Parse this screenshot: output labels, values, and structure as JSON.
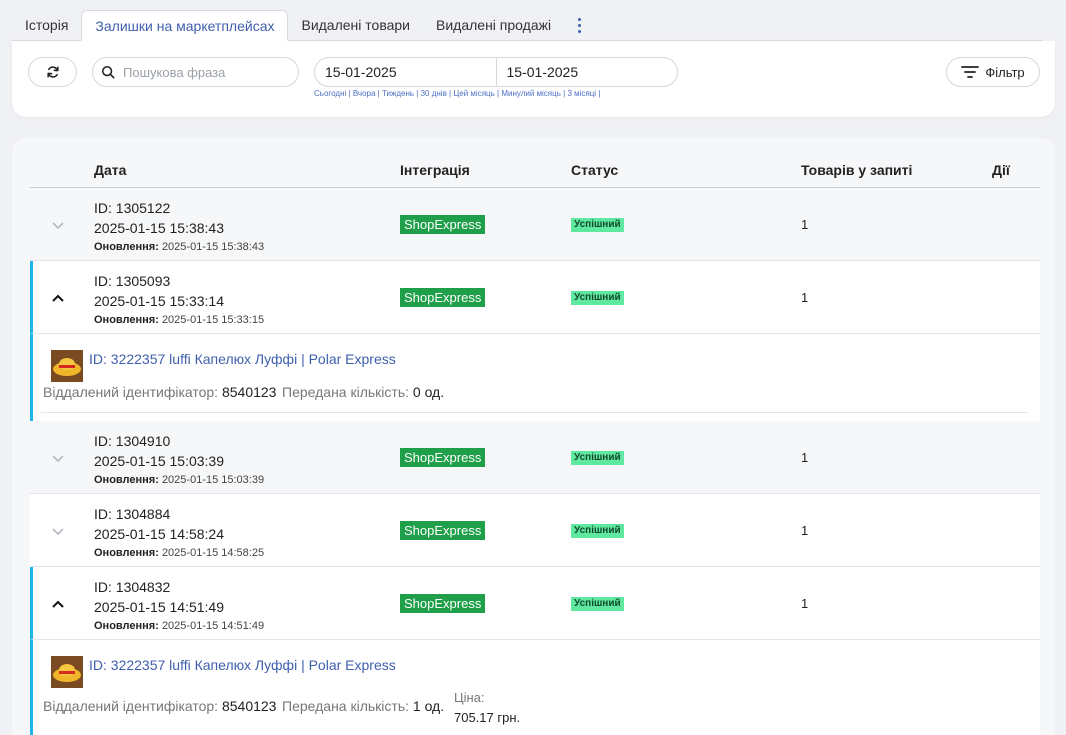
{
  "tabs": [
    {
      "label": "Історія",
      "active": false
    },
    {
      "label": "Залишки на маркетплейсах",
      "active": true
    },
    {
      "label": "Видалені товари",
      "active": false
    },
    {
      "label": "Видалені продажі",
      "active": false
    }
  ],
  "filters": {
    "search_placeholder": "Пошукова фраза",
    "date_from": "15-01-2025",
    "date_to": "15-01-2025",
    "quick_ranges": [
      "Сьогодні",
      "Вчора",
      "Тиждень",
      "30 днів",
      "Цей місяць",
      "Минулий місяць",
      "3 місяці"
    ],
    "filter_label": "Фільтр"
  },
  "table": {
    "headers": {
      "date": "Дата",
      "integration": "Інтеграція",
      "status": "Статус",
      "count": "Товарів у запиті",
      "actions": "Дії"
    },
    "update_label": "Оновлення:",
    "rows": [
      {
        "id": "ID: 1305122",
        "datetime": "2025-01-15 15:38:43",
        "updated": "2025-01-15 15:38:43",
        "integration": "ShopExpress",
        "status": "Успішний",
        "count": "1"
      },
      {
        "id": "ID: 1305093",
        "datetime": "2025-01-15 15:33:14",
        "updated": "2025-01-15 15:33:15",
        "integration": "ShopExpress",
        "status": "Успішний",
        "count": "1"
      },
      {
        "id": "ID: 1304910",
        "datetime": "2025-01-15 15:03:39",
        "updated": "2025-01-15 15:03:39",
        "integration": "ShopExpress",
        "status": "Успішний",
        "count": "1"
      },
      {
        "id": "ID: 1304884",
        "datetime": "2025-01-15 14:58:24",
        "updated": "2025-01-15 14:58:25",
        "integration": "ShopExpress",
        "status": "Успішний",
        "count": "1"
      },
      {
        "id": "ID: 1304832",
        "datetime": "2025-01-15 14:51:49",
        "updated": "2025-01-15 14:51:49",
        "integration": "ShopExpress",
        "status": "Успішний",
        "count": "1"
      }
    ],
    "details": [
      {
        "product": "ID: 3222357 luffi Капелюх Луффі | Polar Express",
        "remote_id_label": "Віддалений ідентифікатор:",
        "remote_id": "8540123",
        "qty_label": "Передана кількість:",
        "qty": "0 од."
      },
      {
        "product": "ID: 3222357 luffi Капелюх Луффі | Polar Express",
        "remote_id_label": "Віддалений ідентифікатор:",
        "remote_id": "8540123",
        "qty_label": "Передана кількість:",
        "qty": "1 од.",
        "price_label": "Ціна:",
        "price": "705.17 грн."
      }
    ]
  },
  "colors": {
    "accent": "#3f5fae",
    "integration_badge": "#1f9f4a",
    "status_badge": "#5ee8a0",
    "expanded_bar": "#1eb6e8"
  }
}
